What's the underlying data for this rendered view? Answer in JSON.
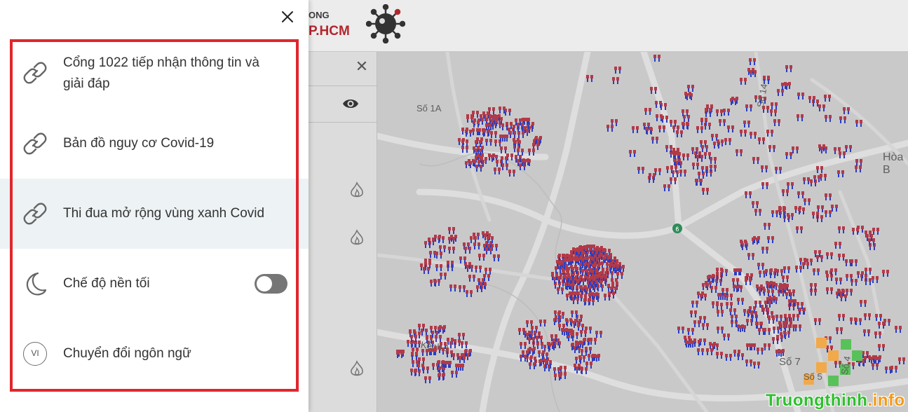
{
  "header": {
    "brand_top": "ONG",
    "brand_bottom": "P.HCM",
    "logo_icon": "virus-logo-icon"
  },
  "side_panel": {
    "close_icon": "close-icon",
    "eye_icon": "eye-icon",
    "flame_icon": "flame-icon"
  },
  "map": {
    "street_labels": [
      "Số 1A",
      "Số 14",
      "Hòa B",
      "Kênh 1",
      "Số 7",
      "Số 5",
      "Số 4"
    ],
    "marker_color": "#b23a48",
    "marker_stem_color": "#2b3dbf",
    "station_color": "#2e8b57"
  },
  "drawer": {
    "close_icon": "close-icon",
    "items": [
      {
        "label_line1": "Cổng 1022 tiếp nhận thông tin và",
        "label_line2": "giải đáp",
        "icon": "link-icon"
      },
      {
        "label": "Bản đồ nguy cơ Covid-19",
        "icon": "link-icon"
      },
      {
        "label": "Thi đua mở rộng vùng xanh Covid",
        "icon": "link-icon",
        "active": true
      },
      {
        "label": "Chế độ nền tối",
        "icon": "moon-icon",
        "toggle_on": false
      },
      {
        "label": "Chuyển đổi ngôn ngữ",
        "icon": "language-icon",
        "badge": "VI"
      }
    ],
    "highlight_color": "#e0262d"
  },
  "watermark": {
    "main": "Truongthinh",
    "suffix": ".info"
  }
}
